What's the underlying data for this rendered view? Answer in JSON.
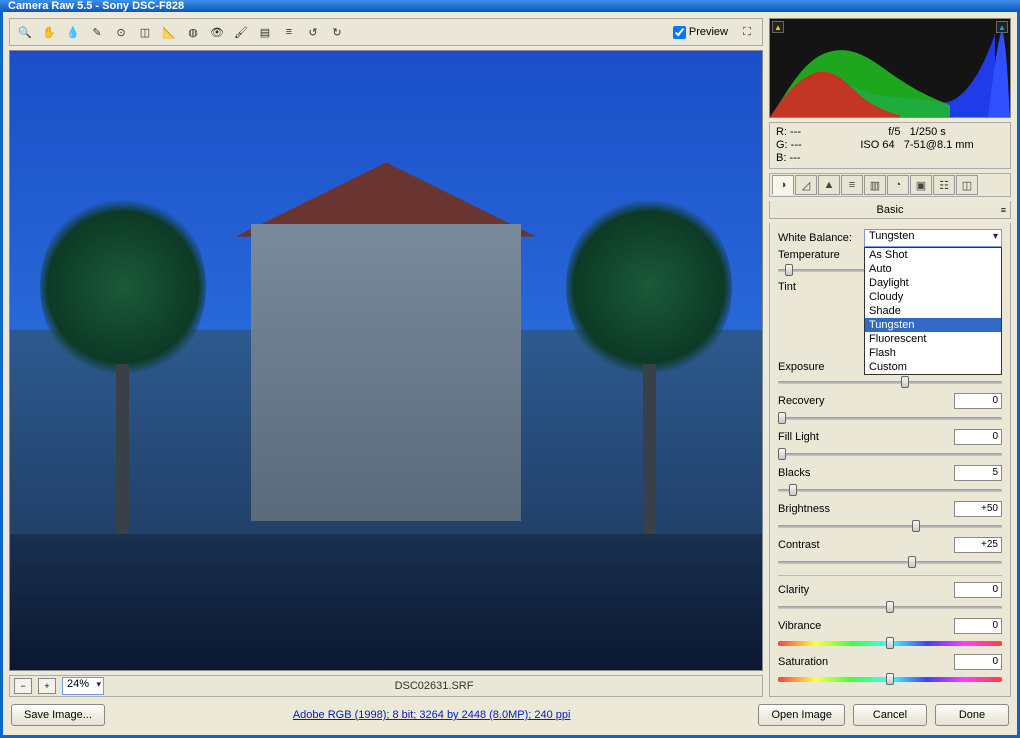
{
  "window": {
    "title": "Camera Raw 5.5  -  Sony DSC-F828"
  },
  "toolbar": {
    "preview_label": "Preview",
    "preview_checked": true
  },
  "status": {
    "zoom": "24%",
    "filename": "DSC02631.SRF"
  },
  "info": {
    "r": "R: ---",
    "g": "G: ---",
    "b": "B: ---",
    "aperture": "f/5",
    "shutter": "1/250 s",
    "iso": "ISO 64",
    "focal": "7-51@8.1 mm"
  },
  "panel": {
    "title": "Basic",
    "white_balance_label": "White Balance:",
    "white_balance_value": "Tungsten",
    "wb_options": [
      "As Shot",
      "Auto",
      "Daylight",
      "Cloudy",
      "Shade",
      "Tungsten",
      "Fluorescent",
      "Flash",
      "Custom"
    ],
    "temperature_label": "Temperature",
    "tint_label": "Tint",
    "exposure_label": "Exposure",
    "recovery_label": "Recovery",
    "recovery_value": "0",
    "fill_label": "Fill Light",
    "fill_value": "0",
    "blacks_label": "Blacks",
    "blacks_value": "5",
    "brightness_label": "Brightness",
    "brightness_value": "+50",
    "contrast_label": "Contrast",
    "contrast_value": "+25",
    "clarity_label": "Clarity",
    "clarity_value": "0",
    "vibrance_label": "Vibrance",
    "vibrance_value": "0",
    "saturation_label": "Saturation",
    "saturation_value": "0"
  },
  "bottom": {
    "save": "Save Image...",
    "link": "Adobe RGB (1998); 8 bit; 3264 by 2448 (8.0MP); 240 ppi",
    "open": "Open Image",
    "cancel": "Cancel",
    "done": "Done"
  }
}
